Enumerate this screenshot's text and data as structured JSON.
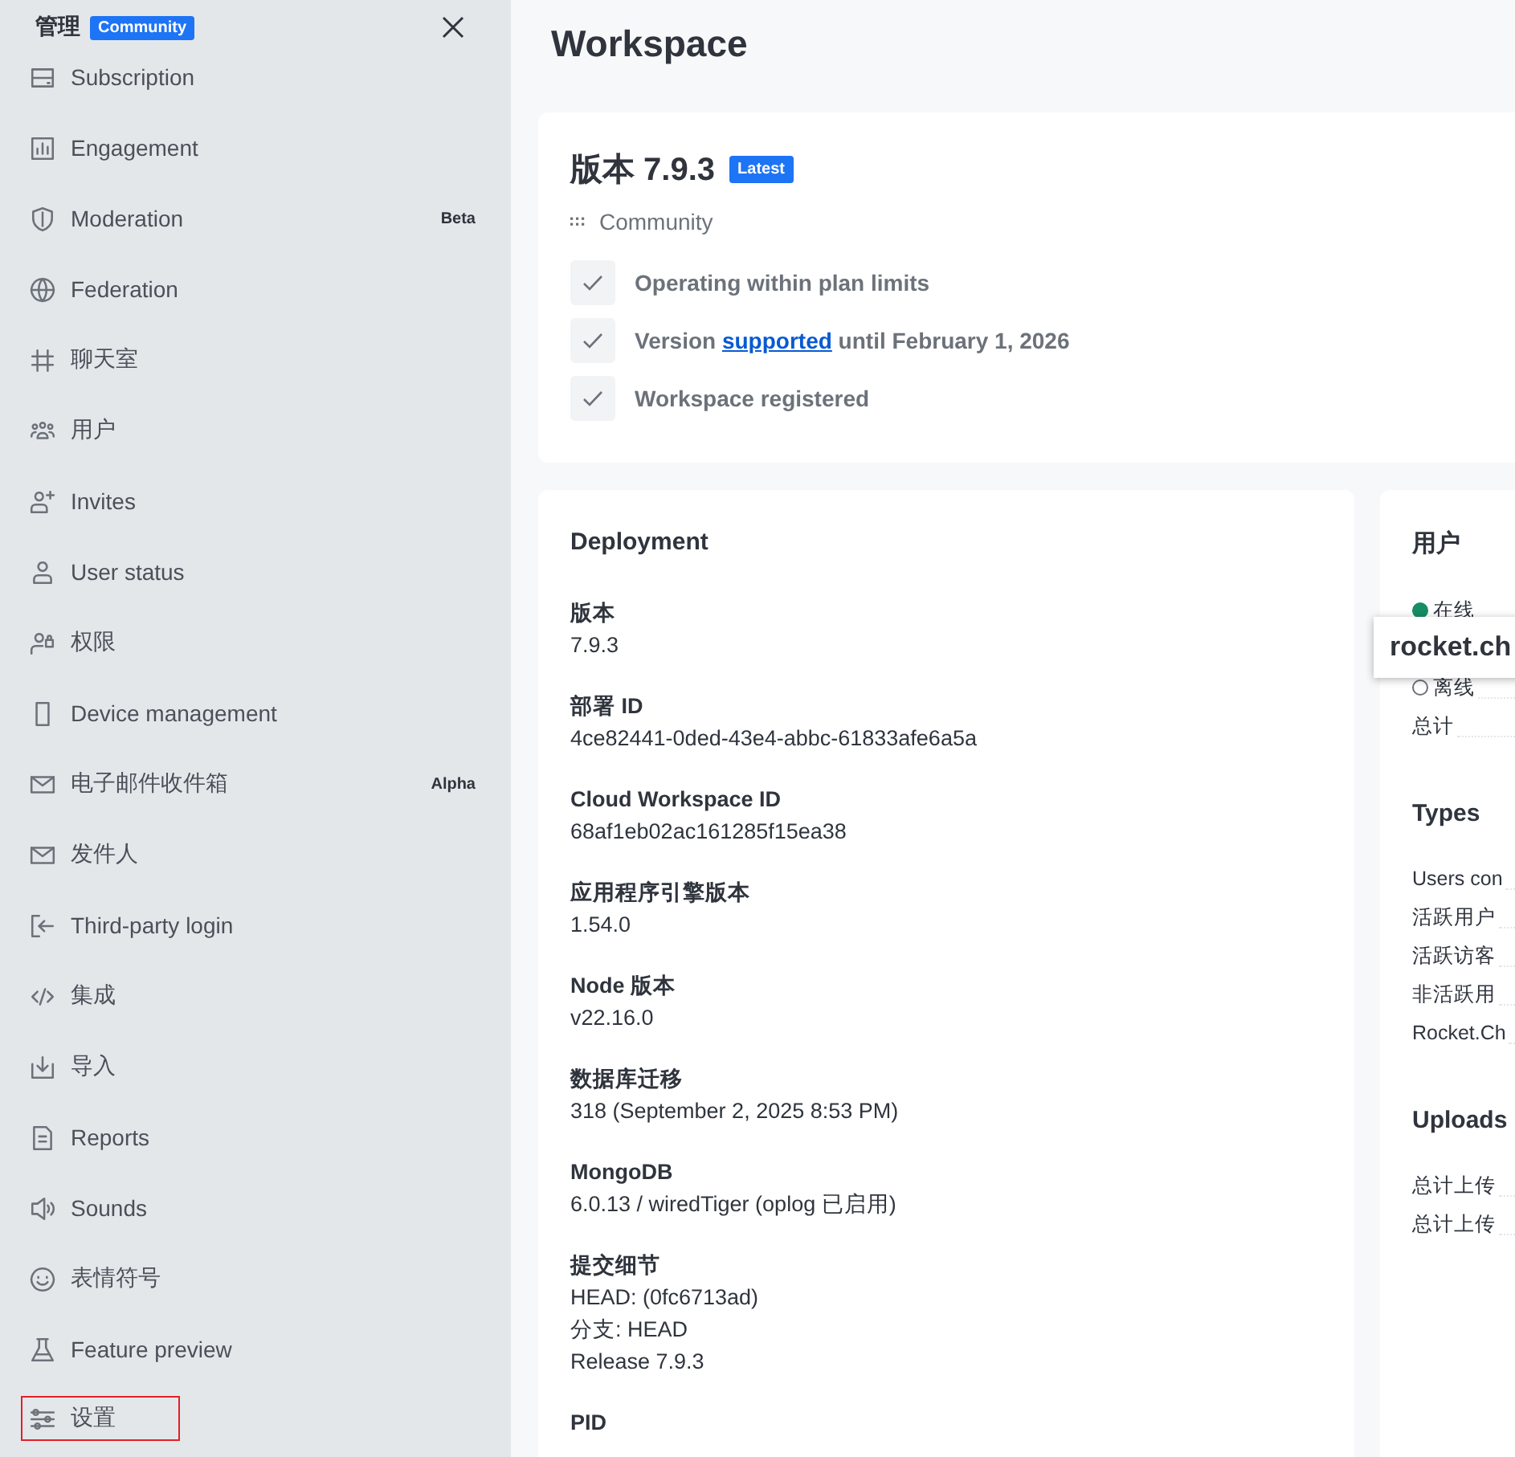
{
  "sidebar": {
    "title": "管理",
    "badge": "Community",
    "items": [
      {
        "label": "Subscription",
        "outlined": false
      },
      {
        "label": "Engagement",
        "outlined": false
      },
      {
        "label": "Moderation",
        "badge": "Beta",
        "outlined": false
      },
      {
        "label": "Federation",
        "outlined": false
      },
      {
        "label": "聊天室",
        "outlined": false
      },
      {
        "label": "用户",
        "outlined": false
      },
      {
        "label": "Invites",
        "outlined": false
      },
      {
        "label": "User status",
        "outlined": false
      },
      {
        "label": "权限",
        "outlined": false
      },
      {
        "label": "Device management",
        "outlined": false
      },
      {
        "label": "电子邮件收件箱",
        "badge": "Alpha",
        "outlined": false
      },
      {
        "label": "发件人",
        "outlined": false
      },
      {
        "label": "Third-party login",
        "outlined": false
      },
      {
        "label": "集成",
        "outlined": false
      },
      {
        "label": "导入",
        "outlined": false
      },
      {
        "label": "Reports",
        "outlined": false
      },
      {
        "label": "Sounds",
        "outlined": false
      },
      {
        "label": "表情符号",
        "outlined": false
      },
      {
        "label": "Feature preview",
        "outlined": false
      },
      {
        "label": "设置",
        "outlined": true
      }
    ]
  },
  "page": {
    "title": "Workspace"
  },
  "version_card": {
    "title": "版本 7.9.3",
    "badge": "Latest",
    "plan": "Community",
    "checks": [
      {
        "text": "Operating within plan limits"
      },
      {
        "before": "Version ",
        "link": "supported",
        "after": " until February 1, 2026"
      },
      {
        "text": "Workspace registered"
      }
    ]
  },
  "deployment": {
    "title": "Deployment",
    "fields": [
      {
        "label": "版本",
        "values": [
          "7.9.3"
        ]
      },
      {
        "label": "部署 ID",
        "values": [
          "4ce82441-0ded-43e4-abbc-61833afe6a5a"
        ]
      },
      {
        "label": "Cloud Workspace ID",
        "values": [
          "68af1eb02ac161285f15ea38"
        ]
      },
      {
        "label": "应用程序引擎版本",
        "values": [
          "1.54.0"
        ]
      },
      {
        "label": "Node 版本",
        "values": [
          "v22.16.0"
        ]
      },
      {
        "label": "数据库迁移",
        "values": [
          "318 (September 2, 2025 8:53 PM)"
        ]
      },
      {
        "label": "MongoDB",
        "values": [
          "6.0.13 / wiredTiger (oplog 已启用)"
        ]
      },
      {
        "label": "提交细节",
        "values": [
          "HEAD: (0fc6713ad)",
          "分支: HEAD",
          "Release 7.9.3"
        ]
      },
      {
        "label": "PID"
      }
    ]
  },
  "stats": {
    "tooltip": "rocket.ch",
    "sections": [
      {
        "title": "用户",
        "rows": [
          {
            "label": "在线",
            "kind": "online"
          },
          {
            "label": "离线",
            "kind": "offline"
          },
          {
            "label": "总计",
            "kind": "plain"
          }
        ]
      },
      {
        "title": "Types",
        "rows": [
          {
            "label": "Users con",
            "kind": "plain"
          },
          {
            "label": "活跃用户",
            "kind": "plain"
          },
          {
            "label": "活跃访客",
            "kind": "plain"
          },
          {
            "label": "非活跃用",
            "kind": "plain"
          },
          {
            "label": "Rocket.Ch",
            "kind": "plain"
          }
        ]
      },
      {
        "title": "Uploads",
        "rows": [
          {
            "label": "总计上传",
            "kind": "plain"
          },
          {
            "label": "总计上传",
            "kind": "plain"
          }
        ]
      }
    ]
  }
}
